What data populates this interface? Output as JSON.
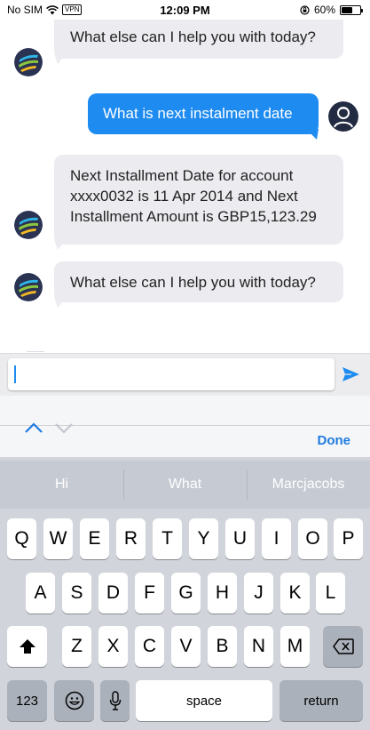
{
  "status_bar": {
    "carrier": "No SIM",
    "vpn": "VPN",
    "time": "12:09 PM",
    "battery_pct": "60%",
    "battery_level": 0.6
  },
  "messages": [
    {
      "sender": "bot",
      "text": "What else can I help you with today?"
    },
    {
      "sender": "user",
      "text": "What is next instalment date"
    },
    {
      "sender": "bot",
      "lines": [
        "Next Installment Date for account",
        "xxxx0032 is 11 Apr 2014 and Next",
        "Installment Amount is GBP15,123.29"
      ]
    },
    {
      "sender": "bot",
      "text": "What else can I help you with today?"
    }
  ],
  "input": {
    "value": "",
    "placeholder": ""
  },
  "accessory": {
    "done_label": "Done"
  },
  "keyboard": {
    "predictions": [
      "Hi",
      "What",
      "Marcjacobs"
    ],
    "row1": [
      "Q",
      "W",
      "E",
      "R",
      "T",
      "Y",
      "U",
      "I",
      "O",
      "P"
    ],
    "row2": [
      "A",
      "S",
      "D",
      "F",
      "G",
      "H",
      "J",
      "K",
      "L"
    ],
    "row3": [
      "Z",
      "X",
      "C",
      "V",
      "B",
      "N",
      "M"
    ],
    "numbers_label": "123",
    "space_label": "space",
    "return_label": "return"
  },
  "colors": {
    "accent": "#1e8bf0",
    "bot_bubble": "#ececf0"
  }
}
